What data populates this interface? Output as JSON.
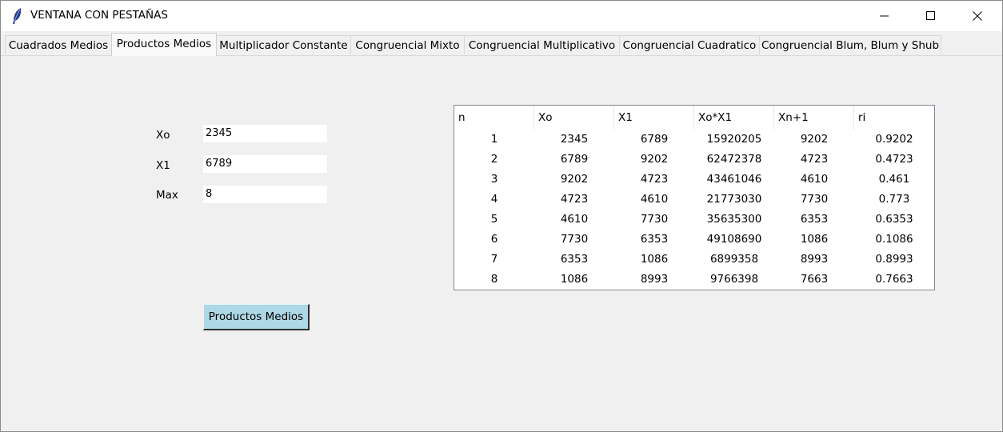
{
  "window": {
    "title": "VENTANA CON PESTAÑAS"
  },
  "tabs": [
    {
      "label": "Cuadrados Medios",
      "active": false
    },
    {
      "label": "Productos Medios",
      "active": true
    },
    {
      "label": "Multiplicador Constante",
      "active": false
    },
    {
      "label": "Congruencial Mixto",
      "active": false
    },
    {
      "label": "Congruencial Multiplicativo",
      "active": false
    },
    {
      "label": "Congruencial Cuadratico",
      "active": false
    },
    {
      "label": "Congruencial Blum, Blum y Shub",
      "active": false
    }
  ],
  "form": {
    "xo_label": "Xo",
    "xo_value": "2345",
    "x1_label": "X1",
    "x1_value": "6789",
    "max_label": "Max",
    "max_value": "8",
    "button_label": "Productos Medios"
  },
  "table": {
    "columns": [
      "n",
      "Xo",
      "X1",
      "Xo*X1",
      "Xn+1",
      "ri"
    ],
    "rows": [
      [
        "1",
        "2345",
        "6789",
        "15920205",
        "9202",
        "0.9202"
      ],
      [
        "2",
        "6789",
        "9202",
        "62472378",
        "4723",
        "0.4723"
      ],
      [
        "3",
        "9202",
        "4723",
        "43461046",
        "4610",
        "0.461"
      ],
      [
        "4",
        "4723",
        "4610",
        "21773030",
        "7730",
        "0.773"
      ],
      [
        "5",
        "4610",
        "7730",
        "35635300",
        "6353",
        "0.6353"
      ],
      [
        "6",
        "7730",
        "6353",
        "49108690",
        "1086",
        "0.1086"
      ],
      [
        "7",
        "6353",
        "1086",
        "6899358",
        "8993",
        "0.8993"
      ],
      [
        "8",
        "1086",
        "8993",
        "9766398",
        "7663",
        "0.7663"
      ]
    ]
  }
}
